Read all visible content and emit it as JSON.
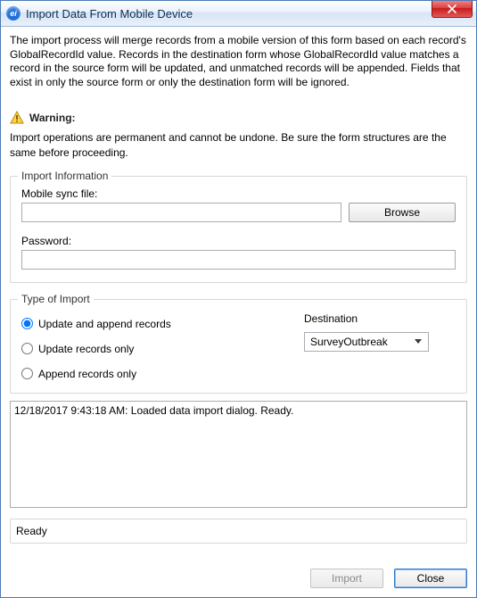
{
  "title": "Import Data From Mobile Device",
  "intro": "The import process will merge records from a mobile version of this form based on each record's GlobalRecordId value. Records in the destination form whose GlobalRecordId value matches a record in the source form will be updated, and unmatched records will be appended. Fields that exist in only the source form or only the destination form will be ignored.",
  "warning": {
    "label": "Warning:",
    "text": "Import operations are permanent and cannot be undone. Be sure the form structures are the same before proceeding."
  },
  "importInfo": {
    "legend": "Import Information",
    "fileLabel": "Mobile sync file:",
    "fileValue": "",
    "browseLabel": "Browse",
    "passwordLabel": "Password:",
    "passwordValue": ""
  },
  "typeOfImport": {
    "legend": "Type of Import",
    "options": {
      "updateAppend": "Update and append records",
      "updateOnly": "Update records only",
      "appendOnly": "Append records only"
    },
    "selected": "updateAppend",
    "destinationLabel": "Destination",
    "destinationValue": "SurveyOutbreak"
  },
  "log": "12/18/2017 9:43:18 AM: Loaded data import dialog. Ready.",
  "status": "Ready",
  "buttons": {
    "import": "Import",
    "close": "Close"
  }
}
